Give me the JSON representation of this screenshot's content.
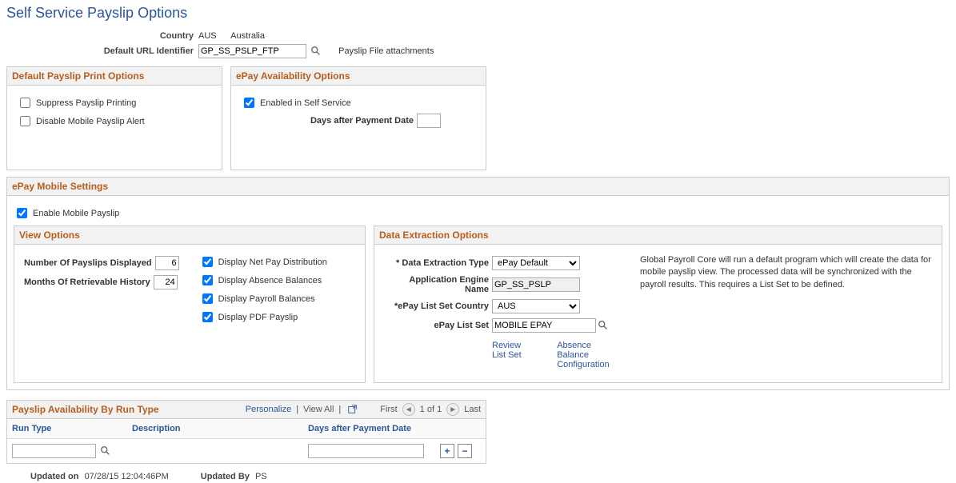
{
  "page": {
    "title": "Self Service Payslip Options"
  },
  "header": {
    "country_label": "Country",
    "country_code": "AUS",
    "country_name": "Australia",
    "url_id_label": "Default URL Identifier",
    "url_id_value": "GP_SS_PSLP_FTP",
    "attachments_text": "Payslip File attachments"
  },
  "print_options": {
    "title": "Default Payslip Print Options",
    "suppress_label": "Suppress Payslip Printing",
    "suppress_checked": false,
    "disable_alert_label": "Disable Mobile Payslip Alert",
    "disable_alert_checked": false
  },
  "epay_availability": {
    "title": "ePay Availability Options",
    "enabled_label": "Enabled in Self Service",
    "enabled_checked": true,
    "days_after_label": "Days after Payment Date",
    "days_after_value": ""
  },
  "epay_mobile": {
    "title": "ePay Mobile Settings",
    "enable_label": "Enable Mobile Payslip",
    "enable_checked": true
  },
  "view_options": {
    "title": "View Options",
    "num_payslips_label": "Number Of Payslips Displayed",
    "num_payslips_value": "6",
    "months_history_label": "Months Of Retrievable History",
    "months_history_value": "24",
    "display_netpay_label": "Display Net Pay Distribution",
    "display_netpay_checked": true,
    "display_absence_label": "Display Absence Balances",
    "display_absence_checked": true,
    "display_payroll_label": "Display Payroll Balances",
    "display_payroll_checked": true,
    "display_pdf_label": "Display PDF Payslip",
    "display_pdf_checked": true
  },
  "data_extraction": {
    "title": "Data Extraction Options",
    "type_label": "* Data Extraction Type",
    "type_value": "ePay Default",
    "ae_name_label": "Application Engine Name",
    "ae_name_value": "GP_SS_PSLP",
    "list_country_label": "*ePay List Set Country",
    "list_country_value": "AUS",
    "list_set_label": "ePay List Set",
    "list_set_value": "MOBILE EPAY",
    "description": "Global Payroll Core will run a default program which will create the data for mobile payslip view. The processed data will be synchronized with the payroll results. This requires a List Set to be defined.",
    "review_link": "Review List Set",
    "absence_link": "Absence Balance Configuration"
  },
  "grid": {
    "title": "Payslip Availability By Run Type",
    "personalize": "Personalize",
    "view_all": "View All",
    "first": "First",
    "counter": "1 of 1",
    "last": "Last",
    "columns": {
      "run_type": "Run Type",
      "description": "Description",
      "days_after": "Days after Payment Date"
    },
    "row": {
      "run_type": "",
      "description": "",
      "days_after": ""
    }
  },
  "footer": {
    "updated_on_label": "Updated on",
    "updated_on_value": "07/28/15 12:04:46PM",
    "updated_by_label": "Updated By",
    "updated_by_value": "PS"
  }
}
